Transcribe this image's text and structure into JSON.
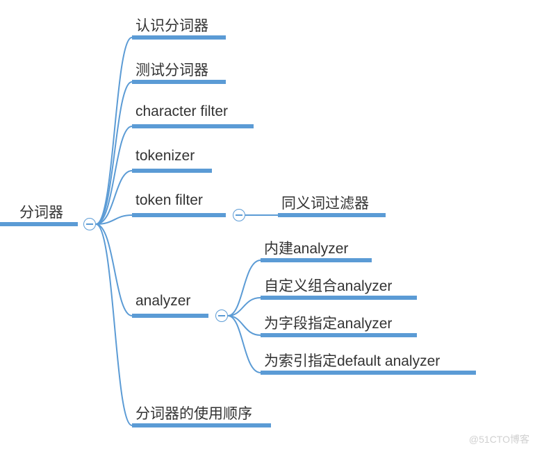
{
  "root": {
    "label": "分词器"
  },
  "children": [
    {
      "key": "c1",
      "label": "认识分词器"
    },
    {
      "key": "c2",
      "label": "测试分词器"
    },
    {
      "key": "c3",
      "label": "character filter"
    },
    {
      "key": "c4",
      "label": "tokenizer"
    },
    {
      "key": "c5",
      "label": "token filter",
      "children": [
        {
          "key": "c5a",
          "label": "同义词过滤器"
        }
      ]
    },
    {
      "key": "c6",
      "label": "analyzer",
      "children": [
        {
          "key": "c6a",
          "label": "内建analyzer"
        },
        {
          "key": "c6b",
          "label": "自定义组合analyzer"
        },
        {
          "key": "c6c",
          "label": "为字段指定analyzer"
        },
        {
          "key": "c6d",
          "label": "为索引指定default analyzer"
        }
      ]
    },
    {
      "key": "c7",
      "label": "分词器的使用顺序"
    }
  ],
  "watermark": "@51CTO博客",
  "colors": {
    "line": "#5B9BD5"
  }
}
